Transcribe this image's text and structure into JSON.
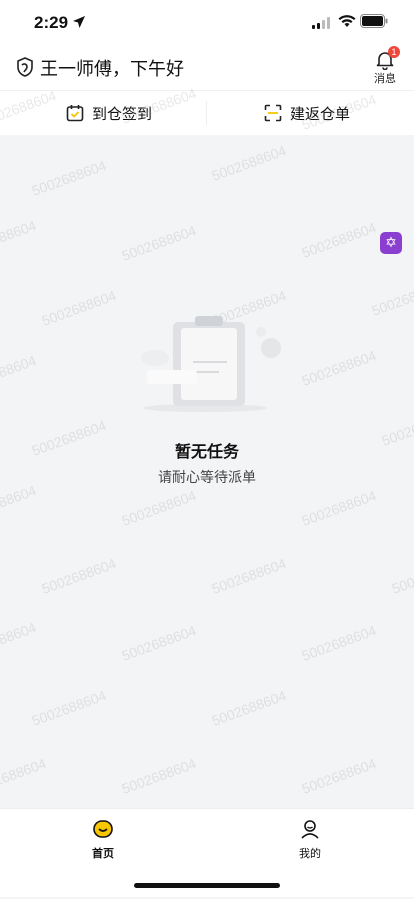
{
  "status_bar": {
    "time": "2:29"
  },
  "header": {
    "greeting": "王一师傅，下午好",
    "message_label": "消息",
    "message_badge": "1"
  },
  "actions": {
    "checkin": "到仓签到",
    "build_return": "建返仓单"
  },
  "empty_state": {
    "title": "暂无任务",
    "subtitle": "请耐心等待派单"
  },
  "watermark": "5002688604",
  "tabs": [
    {
      "label": "首页"
    },
    {
      "label": "我的"
    }
  ],
  "colors": {
    "accent": "#f7c600",
    "badge": "#f0473c",
    "float_button": "#8b3fd0"
  }
}
